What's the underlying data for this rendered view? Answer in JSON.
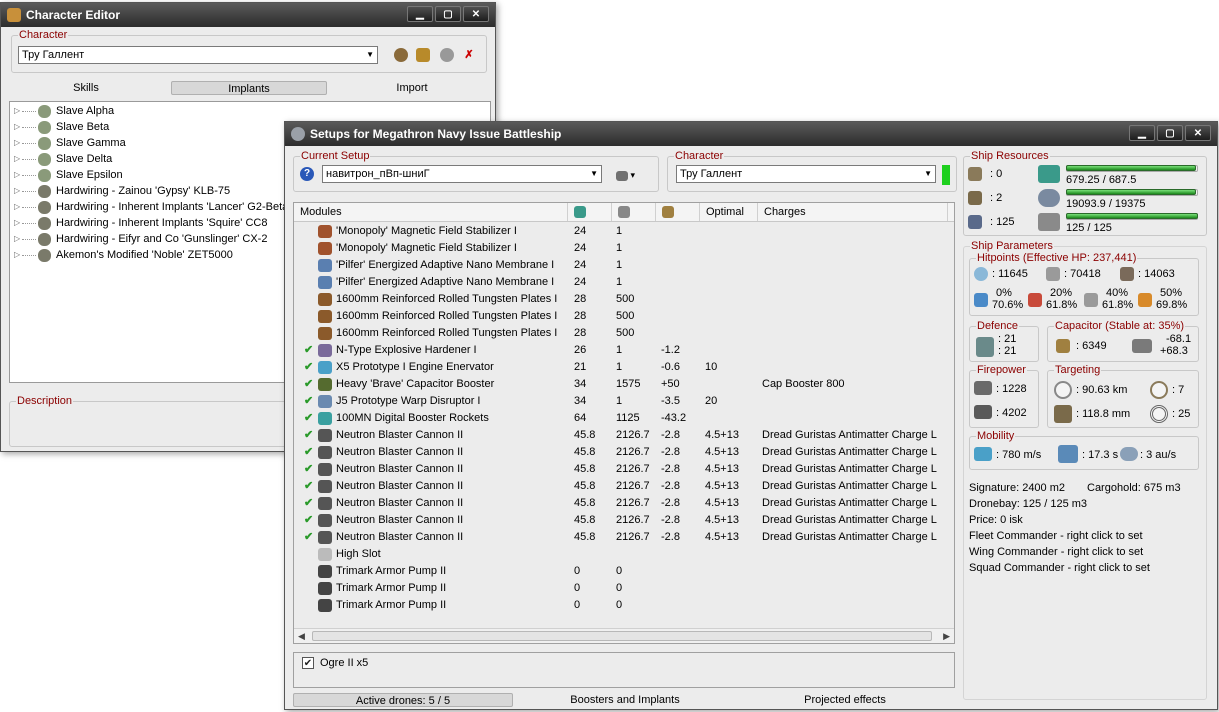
{
  "char_editor": {
    "title": "Character Editor",
    "character_label": "Character",
    "character_value": "Тру Галлент",
    "tabs": [
      "Skills",
      "Implants",
      "Import"
    ],
    "implants": [
      "Slave Alpha",
      "Slave Beta",
      "Slave Gamma",
      "Slave Delta",
      "Slave Epsilon",
      "Hardwiring - Zainou 'Gypsy' KLB-75",
      "Hardwiring - Inherent Implants 'Lancer' G2-Beta",
      "Hardwiring - Inherent Implants 'Squire' CC8",
      "Hardwiring - Eifyr and Co 'Gunslinger' CX-2",
      "Akemon's Modified 'Noble' ZET5000"
    ],
    "description_label": "Description"
  },
  "setups": {
    "title": "Setups for Megathron Navy Issue Battleship",
    "current_setup_label": "Current Setup",
    "current_setup_value": "навитрон_пВп-шниГ",
    "character_label": "Character",
    "character_value": "Тру Галлент",
    "columns": [
      "Modules",
      "",
      "",
      "",
      "Optimal",
      "Charges"
    ],
    "modules": [
      {
        "check": "",
        "name": "'Monopoly' Magnetic Field Stabilizer I",
        "c1": "24",
        "c2": "1",
        "c3": "",
        "optimal": "",
        "charge": "",
        "icon": "#a0522d"
      },
      {
        "check": "",
        "name": "'Monopoly' Magnetic Field Stabilizer I",
        "c1": "24",
        "c2": "1",
        "c3": "",
        "optimal": "",
        "charge": "",
        "icon": "#a0522d"
      },
      {
        "check": "",
        "name": "'Pilfer' Energized Adaptive Nano Membrane I",
        "c1": "24",
        "c2": "1",
        "c3": "",
        "optimal": "",
        "charge": "",
        "icon": "#5a7fb0"
      },
      {
        "check": "",
        "name": "'Pilfer' Energized Adaptive Nano Membrane I",
        "c1": "24",
        "c2": "1",
        "c3": "",
        "optimal": "",
        "charge": "",
        "icon": "#5a7fb0"
      },
      {
        "check": "",
        "name": "1600mm Reinforced Rolled Tungsten Plates I",
        "c1": "28",
        "c2": "500",
        "c3": "",
        "optimal": "",
        "charge": "",
        "icon": "#8b5a2b"
      },
      {
        "check": "",
        "name": "1600mm Reinforced Rolled Tungsten Plates I",
        "c1": "28",
        "c2": "500",
        "c3": "",
        "optimal": "",
        "charge": "",
        "icon": "#8b5a2b"
      },
      {
        "check": "",
        "name": "1600mm Reinforced Rolled Tungsten Plates I",
        "c1": "28",
        "c2": "500",
        "c3": "",
        "optimal": "",
        "charge": "",
        "icon": "#8b5a2b"
      },
      {
        "check": "✔",
        "name": "N-Type Explosive Hardener I",
        "c1": "26",
        "c2": "1",
        "c3": "-1.2",
        "optimal": "",
        "charge": "",
        "icon": "#7a6a9a"
      },
      {
        "check": "✔",
        "name": "X5 Prototype I Engine Enervator",
        "c1": "21",
        "c2": "1",
        "c3": "-0.6",
        "optimal": "10",
        "charge": "",
        "icon": "#4aa0c8"
      },
      {
        "check": "✔",
        "name": "Heavy 'Brave' Capacitor Booster",
        "c1": "34",
        "c2": "1575",
        "c3": "+50",
        "optimal": "",
        "charge": "Cap Booster 800",
        "icon": "#556b2f"
      },
      {
        "check": "✔",
        "name": "J5 Prototype Warp Disruptor I",
        "c1": "34",
        "c2": "1",
        "c3": "-3.5",
        "optimal": "20",
        "charge": "",
        "icon": "#6a8ab0"
      },
      {
        "check": "✔",
        "name": "100MN Digital Booster Rockets",
        "c1": "64",
        "c2": "1125",
        "c3": "-43.2",
        "optimal": "",
        "charge": "",
        "icon": "#3aa0a0"
      },
      {
        "check": "✔",
        "name": "Neutron Blaster Cannon II",
        "c1": "45.8",
        "c2": "2126.7",
        "c3": "-2.8",
        "optimal": "4.5+13",
        "charge": "Dread Guristas Antimatter Charge L",
        "icon": "#555555"
      },
      {
        "check": "✔",
        "name": "Neutron Blaster Cannon II",
        "c1": "45.8",
        "c2": "2126.7",
        "c3": "-2.8",
        "optimal": "4.5+13",
        "charge": "Dread Guristas Antimatter Charge L",
        "icon": "#555555"
      },
      {
        "check": "✔",
        "name": "Neutron Blaster Cannon II",
        "c1": "45.8",
        "c2": "2126.7",
        "c3": "-2.8",
        "optimal": "4.5+13",
        "charge": "Dread Guristas Antimatter Charge L",
        "icon": "#555555"
      },
      {
        "check": "✔",
        "name": "Neutron Blaster Cannon II",
        "c1": "45.8",
        "c2": "2126.7",
        "c3": "-2.8",
        "optimal": "4.5+13",
        "charge": "Dread Guristas Antimatter Charge L",
        "icon": "#555555"
      },
      {
        "check": "✔",
        "name": "Neutron Blaster Cannon II",
        "c1": "45.8",
        "c2": "2126.7",
        "c3": "-2.8",
        "optimal": "4.5+13",
        "charge": "Dread Guristas Antimatter Charge L",
        "icon": "#555555"
      },
      {
        "check": "✔",
        "name": "Neutron Blaster Cannon II",
        "c1": "45.8",
        "c2": "2126.7",
        "c3": "-2.8",
        "optimal": "4.5+13",
        "charge": "Dread Guristas Antimatter Charge L",
        "icon": "#555555"
      },
      {
        "check": "✔",
        "name": "Neutron Blaster Cannon II",
        "c1": "45.8",
        "c2": "2126.7",
        "c3": "-2.8",
        "optimal": "4.5+13",
        "charge": "Dread Guristas Antimatter Charge L",
        "icon": "#555555"
      },
      {
        "check": "",
        "name": "High Slot",
        "c1": "",
        "c2": "",
        "c3": "",
        "optimal": "",
        "charge": "",
        "icon": "#bbbbbb"
      },
      {
        "check": "",
        "name": "Trimark Armor Pump II",
        "c1": "0",
        "c2": "0",
        "c3": "",
        "optimal": "",
        "charge": "",
        "icon": "#444444"
      },
      {
        "check": "",
        "name": "Trimark Armor Pump II",
        "c1": "0",
        "c2": "0",
        "c3": "",
        "optimal": "",
        "charge": "",
        "icon": "#444444"
      },
      {
        "check": "",
        "name": "Trimark Armor Pump II",
        "c1": "0",
        "c2": "0",
        "c3": "",
        "optimal": "",
        "charge": "",
        "icon": "#444444"
      }
    ],
    "drone": "Ogre II x5",
    "bottom_tabs": [
      "Active drones: 5 / 5",
      "Boosters and Implants",
      "Projected effects"
    ]
  },
  "resources": {
    "label": "Ship Resources",
    "slots": [
      ": 0",
      ": 2",
      ": 125"
    ],
    "cpu": "679.25 / 687.5",
    "power": "19093.9 / 19375",
    "bandwidth": "125 / 125",
    "cpu_frac": 0.988,
    "power_frac": 0.985,
    "bw_frac": 1.0
  },
  "params": {
    "label": "Ship Parameters",
    "hp_label": "Hitpoints (Effective HP: 237,441)",
    "shield": ": 11645",
    "armor": ": 70418",
    "hull": ": 14063",
    "res_top": [
      "0%",
      "20%",
      "40%",
      "50%"
    ],
    "res_bot": [
      "70.6%",
      "61.8%",
      "61.8%",
      "69.8%"
    ],
    "defence_label": "Defence",
    "def_vals": [
      ": 21",
      ": 21"
    ],
    "cap_label": "Capacitor (Stable at: 35%)",
    "cap_amount": ": 6349",
    "cap_rates": [
      "-68.1",
      "+68.3"
    ],
    "fire_label": "Firepower",
    "fire_vals": [
      ": 1228",
      ": 4202"
    ],
    "target_label": "Targeting",
    "target_range": ": 90.63 km",
    "target_count": ": 7",
    "scan_res": ": 118.8 mm",
    "sensor": ": 25",
    "mobility_label": "Mobility",
    "speed": ": 780 m/s",
    "align": ": 17.3 s",
    "warp": ": 3 au/s",
    "signature": "Signature: 2400 m2",
    "cargohold": "Cargohold: 675 m3",
    "dronebay": "Dronebay: 125 / 125 m3",
    "price": "Price: 0 isk",
    "fleet": "Fleet Commander - right click to set",
    "wing": "Wing Commander - right click to set",
    "squad": "Squad Commander - right click to set"
  }
}
